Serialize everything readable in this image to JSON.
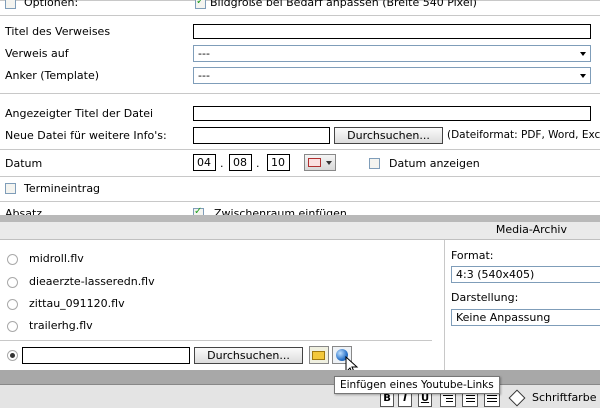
{
  "form": {
    "optionen_label": "Optionen:",
    "bildgroesse_label": "Bildgröße bei Bedarf anpassen (Breite 540 Pixel)",
    "titel_label": "Titel des Verweises",
    "titel_value": "",
    "verweis_label": "Verweis auf",
    "verweis_value": "---",
    "anker_label": "Anker (Template)",
    "anker_value": "---",
    "angezeigter_titel_label": "Angezeigter Titel der Datei",
    "angezeigter_titel_value": "",
    "neue_datei_label": "Neue Datei für weitere Info's:",
    "durchsuchen_label": "Durchsuchen...",
    "dateiformat_hint": "(Dateiformat: PDF, Word, Excel",
    "datum_label": "Datum",
    "datum_day": "04",
    "datum_month": "08",
    "datum_year": "10",
    "datum_sep": ".",
    "datum_anzeigen_label": "Datum anzeigen",
    "termineintrag_label": "Termineintrag",
    "absatz_label": "Absatz",
    "zwischenraum_label": "Zwischenraum einfügen"
  },
  "media": {
    "title": "Media-Archiv",
    "files": [
      {
        "name": "midroll.flv"
      },
      {
        "name": "dieaerzte-lasseredn.flv"
      },
      {
        "name": "zittau_091120.flv"
      },
      {
        "name": "trailerhg.flv"
      }
    ],
    "upload_value": "",
    "durchsuchen_label": "Durchsuchen...",
    "format_label": "Format:",
    "format_value": "4:3 (540x405)",
    "darstellung_label": "Darstellung:",
    "darstellung_value": "Keine Anpassung",
    "tooltip": "Einfügen eines Youtube-Links"
  },
  "toolbar": {
    "bold": "B",
    "italic": "I",
    "underline": "U",
    "schriftfarbe_label": "Schriftfarbe"
  }
}
